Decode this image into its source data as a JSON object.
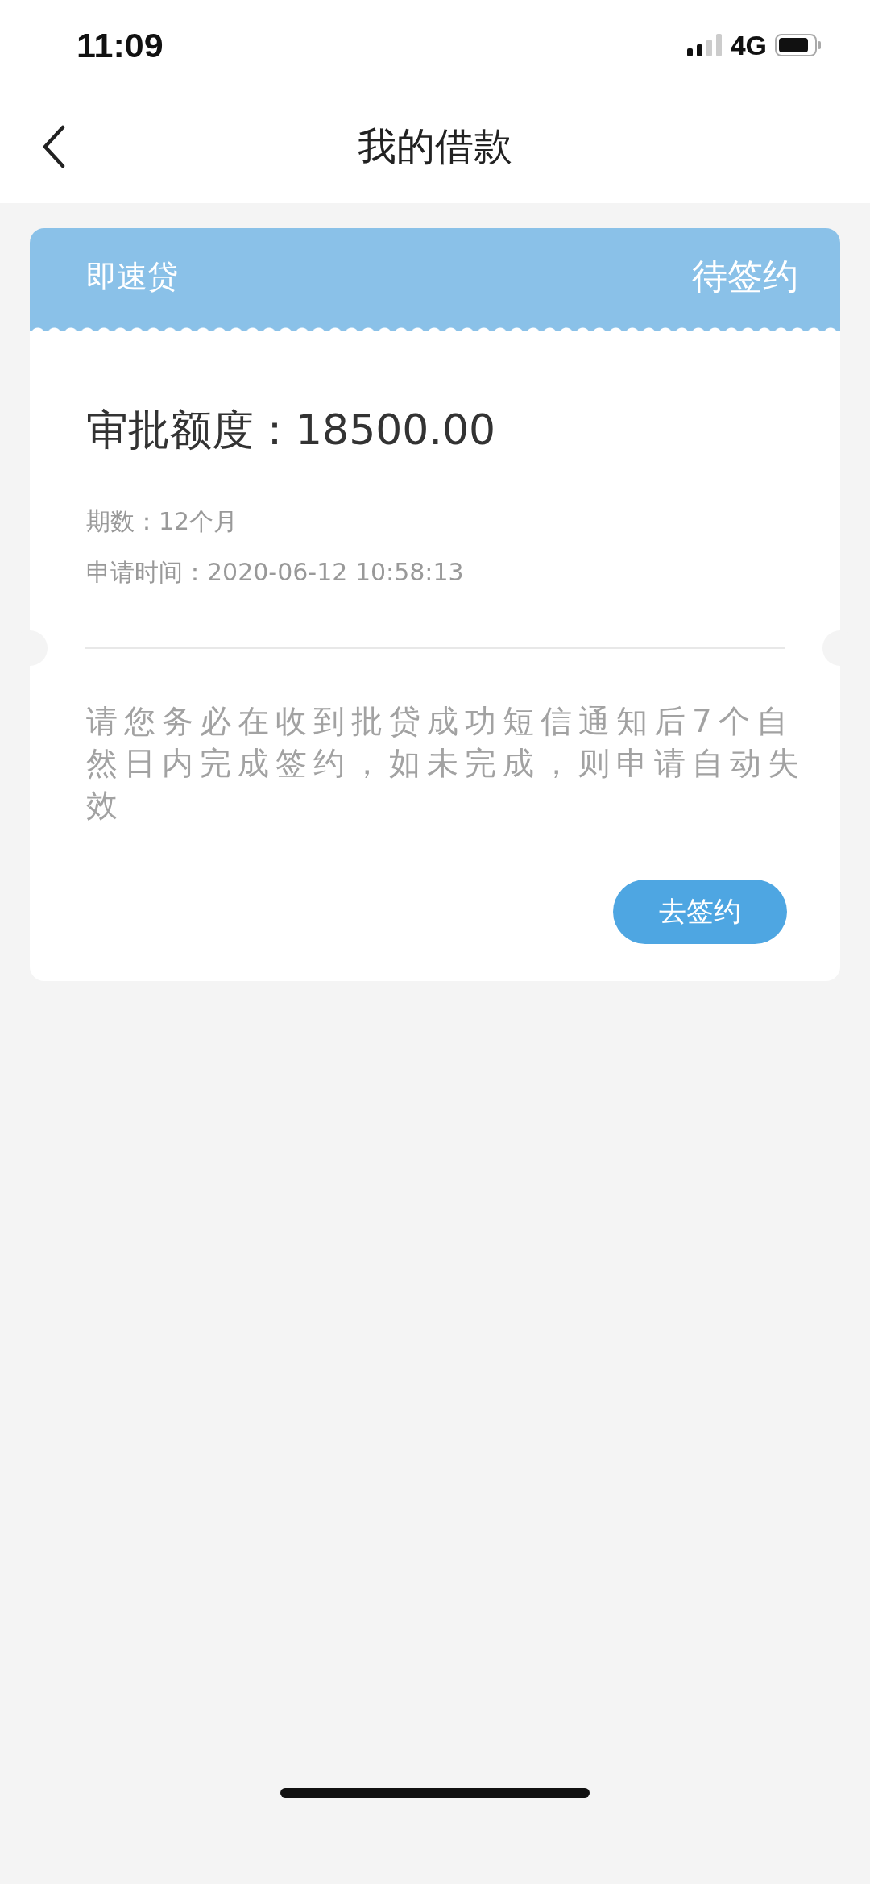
{
  "status_bar": {
    "time": "11:09",
    "network": "4G"
  },
  "nav": {
    "title": "我的借款"
  },
  "loan": {
    "product": "即速贷",
    "status": "待签约",
    "amount": "审批额度：18500.00",
    "term": "期数：12个月",
    "applied_at": "申请时间：2020-06-12 10:58:13",
    "notice": "请您务必在收到批贷成功短信通知后7个自然日内完成签约，如未完成，则申请自动失效",
    "action": "去签约"
  }
}
